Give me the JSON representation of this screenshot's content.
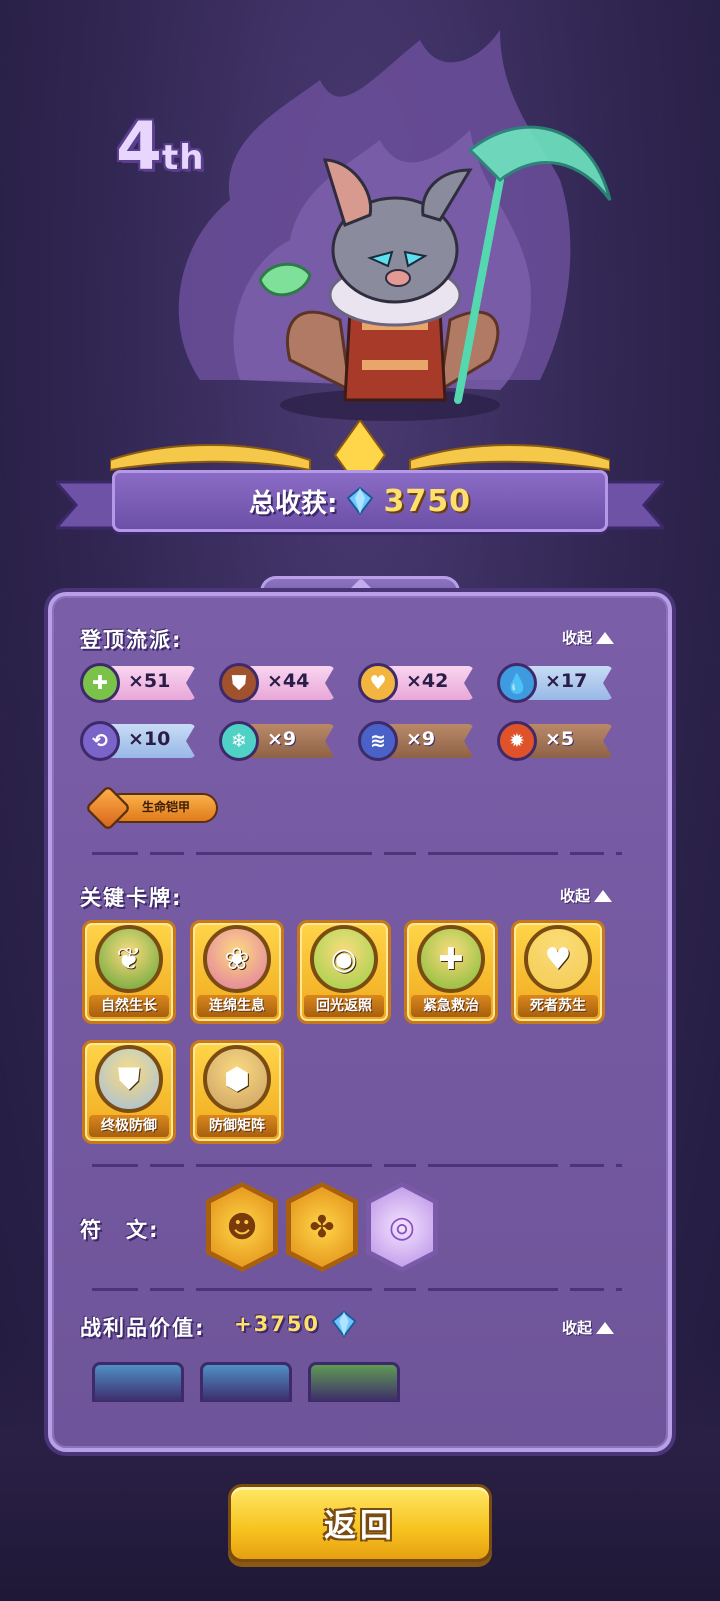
{
  "rank": {
    "number": "4",
    "suffix": "th"
  },
  "total": {
    "label": "总收获:",
    "value": "3750",
    "icon": "crystal-icon"
  },
  "schools": {
    "title": "登顶流派:",
    "collapse_label": "收起",
    "items": [
      {
        "icon": "heal-cross-icon",
        "count": "×51",
        "style": "pink",
        "color": "#7bc24a"
      },
      {
        "icon": "shield-icon",
        "count": "×44",
        "style": "pink",
        "color": "#a0522d"
      },
      {
        "icon": "heart-icon",
        "count": "×42",
        "style": "pink",
        "color": "#f2b640"
      },
      {
        "icon": "water-drop-icon",
        "count": "×17",
        "style": "blue",
        "color": "#3f9be0"
      },
      {
        "icon": "swirl-icon",
        "count": "×10",
        "style": "blue",
        "color": "#7a63c9"
      },
      {
        "icon": "snowflake-icon",
        "count": "×9",
        "style": "brown",
        "color": "#4fd1c5"
      },
      {
        "icon": "wind-icon",
        "count": "×9",
        "style": "brown",
        "color": "#4a62c8"
      },
      {
        "icon": "flame-icon",
        "count": "×5",
        "style": "brown",
        "color": "#e0522a"
      }
    ],
    "special": {
      "icon": "life-armor-icon",
      "label": "生命铠甲"
    }
  },
  "cards": {
    "title": "关键卡牌:",
    "collapse_label": "收起",
    "items": [
      {
        "name": "自然生长",
        "icon": "vine-icon",
        "color": "#5fa83a"
      },
      {
        "name": "连绵生息",
        "icon": "lotus-icon",
        "color": "#e27aa8"
      },
      {
        "name": "回光返照",
        "icon": "glow-orb-icon",
        "color": "#9ad44a"
      },
      {
        "name": "紧急救治",
        "icon": "syringe-icon",
        "color": "#7fbf3a"
      },
      {
        "name": "死者苏生",
        "icon": "winged-heart-icon",
        "color": "#f3d050"
      },
      {
        "name": "终极防御",
        "icon": "shield-icon",
        "color": "#9fc3e8"
      },
      {
        "name": "防御矩阵",
        "icon": "hex-matrix-icon",
        "color": "#c9a36a"
      }
    ]
  },
  "runes": {
    "title": "符　文:",
    "items": [
      {
        "icon": "demon-face-rune-icon",
        "style": "gold"
      },
      {
        "icon": "puzzle-rune-icon",
        "style": "gold"
      },
      {
        "icon": "ring-gem-rune-icon",
        "style": "purple"
      }
    ]
  },
  "loot": {
    "title": "战利品价值:",
    "value": "+3750",
    "icon": "crystal-icon",
    "collapse_label": "收起",
    "items": [
      {
        "icon": "blue-item-icon",
        "color": "#4e8fc4"
      },
      {
        "icon": "blue-item-icon",
        "color": "#4e8fc4"
      },
      {
        "icon": "green-item-icon",
        "color": "#5f9a55"
      }
    ]
  },
  "back_button": {
    "label": "返回"
  }
}
